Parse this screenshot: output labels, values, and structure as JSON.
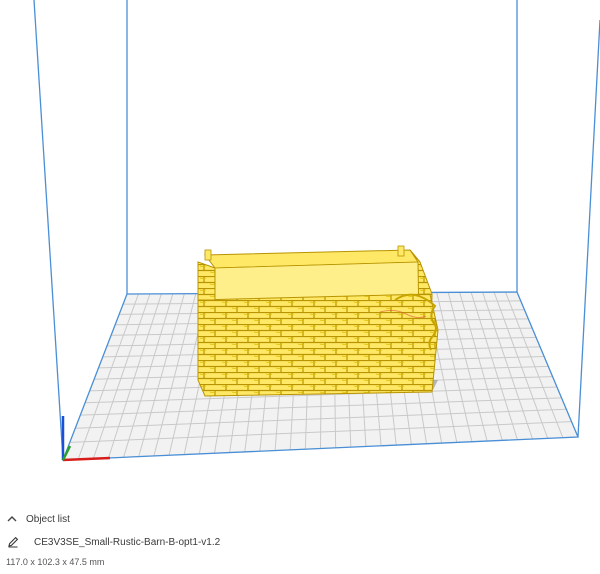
{
  "object_list": {
    "header_label": "Object list",
    "file_name": "CE3V3SE_Small-Rustic-Barn-B-opt1-v1.2",
    "dimensions": "117.0 x 102.3 x 47.5 mm"
  },
  "icons": {
    "collapse": "chevron-up-icon",
    "edit": "pencil-icon"
  },
  "colors": {
    "build_volume_edges": "#4a8fd6",
    "grid_lines": "#c9c9c9",
    "build_plate": "#f2f2f2",
    "model_fill": "#ffe866",
    "model_outline": "#c8a400",
    "axis_x": "#d81c1c",
    "axis_y": "#2aa02a",
    "axis_z": "#1c4fd8"
  }
}
